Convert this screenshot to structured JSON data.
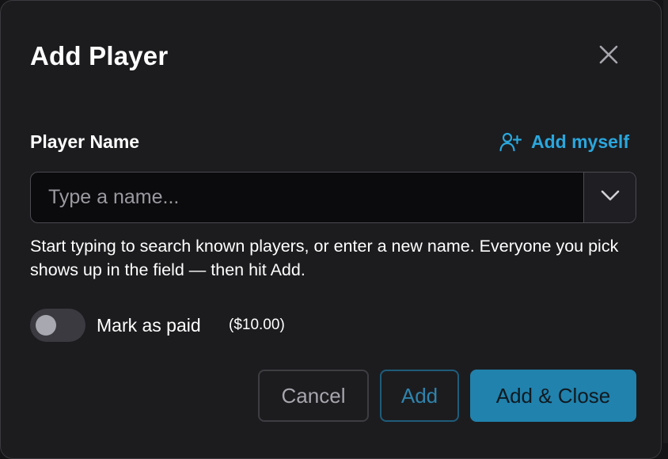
{
  "dialog": {
    "title": "Add Player",
    "close_icon": "close-icon"
  },
  "field": {
    "label": "Player Name",
    "add_myself_label": "Add myself",
    "add_myself_icon": "user-plus-icon",
    "placeholder": "Type a name...",
    "value": "",
    "dropdown_icon": "chevron-down-icon",
    "help_text": "Start typing to search known players, or enter a new name. Everyone you pick shows up in the field — then hit Add."
  },
  "paid": {
    "label": "Mark as paid",
    "price": "($10.00)",
    "checked": false
  },
  "buttons": {
    "cancel": "Cancel",
    "add": "Add",
    "add_close": "Add & Close"
  },
  "colors": {
    "accent": "#2aa7dd",
    "primary_button": "#2182ad",
    "dialog_bg": "#1c1c1f",
    "input_bg": "#0b0b0d"
  }
}
